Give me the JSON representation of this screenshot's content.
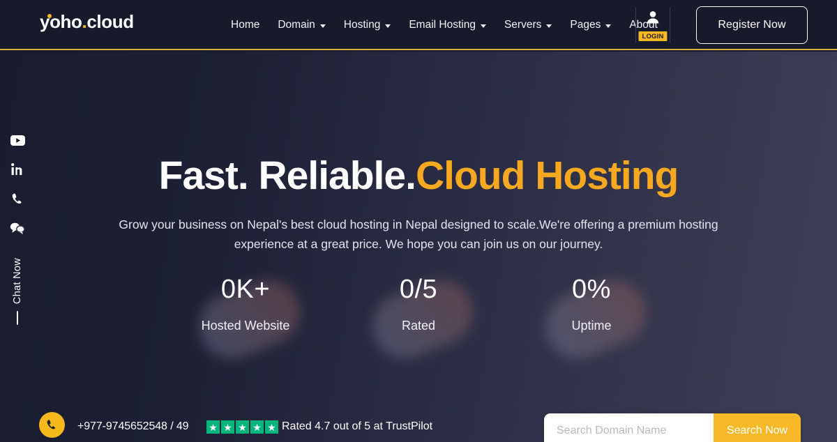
{
  "header": {
    "logo": {
      "prefix": "y",
      "middle": "oho",
      "separator": ".",
      "suffix": "cloud",
      "full": "yoho.cloud"
    },
    "nav": [
      {
        "label": "Home",
        "has_dropdown": false
      },
      {
        "label": "Domain",
        "has_dropdown": true
      },
      {
        "label": "Hosting",
        "has_dropdown": true
      },
      {
        "label": "Email Hosting",
        "has_dropdown": true
      },
      {
        "label": "Servers",
        "has_dropdown": true
      },
      {
        "label": "Pages",
        "has_dropdown": true
      },
      {
        "label": "About",
        "has_dropdown": false
      }
    ],
    "login_badge": "LOGIN",
    "register_label": "Register Now",
    "accent_color": "#f5b91c",
    "background_color": "#171a2b",
    "border_color": "#d6b43c"
  },
  "sidebar": {
    "icons": [
      {
        "name": "youtube-icon"
      },
      {
        "name": "linkedin-icon"
      },
      {
        "name": "phone-icon"
      },
      {
        "name": "chat-bubbles-icon"
      }
    ],
    "chat_label": "Chat Now"
  },
  "hero": {
    "headline_white": "Fast. Reliable.",
    "headline_accent": "Cloud Hosting",
    "headline_accent_color": "#f5a820",
    "subtitle": "Grow your business on Nepal's best cloud hosting in Nepal designed to scale.We're offering a premium hosting experience at a great price. We hope you can join us on our journey.",
    "background_from": "#191c2e",
    "background_to": "#3e3f57",
    "stats": [
      {
        "value": "0K+",
        "label": "Hosted Website"
      },
      {
        "value": "0/5",
        "label": "Rated"
      },
      {
        "value": "0%",
        "label": "Uptime"
      }
    ]
  },
  "bottom_bar": {
    "phone_icon": "phone-icon",
    "phone_number": "+977-9745652548 / 49",
    "stars": {
      "count": 5,
      "glyph": "★",
      "color": "#00b67a"
    },
    "rating_text": "Rated 4.7 out of 5 at TrustPilot",
    "search": {
      "placeholder": "Search Domain Name",
      "value": "",
      "button_label": "Search Now",
      "button_color": "#f8b929"
    }
  }
}
